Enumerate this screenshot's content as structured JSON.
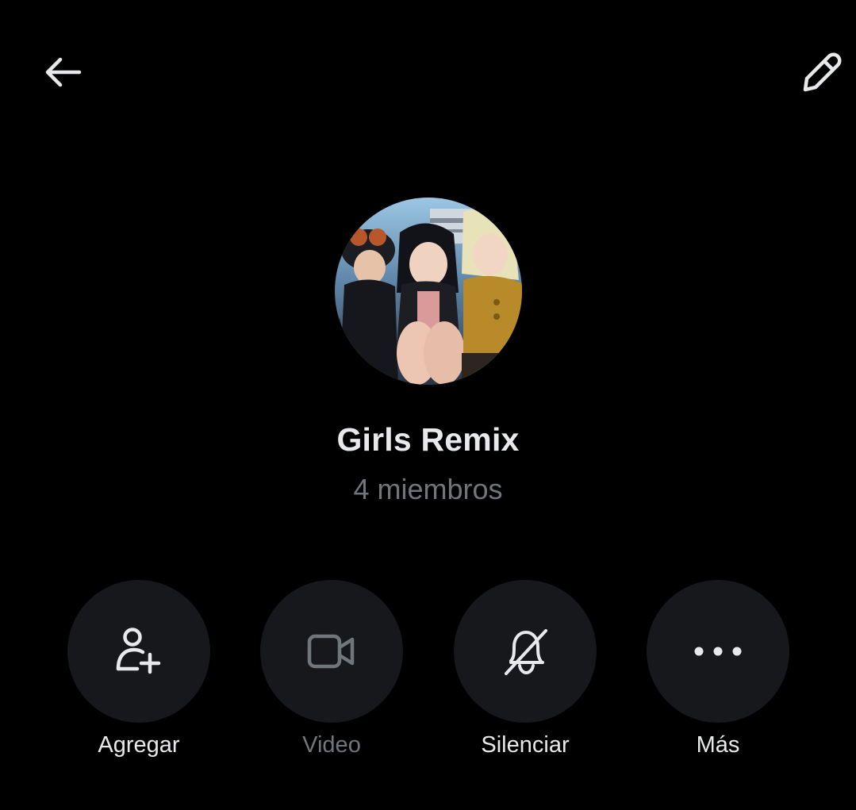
{
  "header": {
    "back_icon": "arrow-left-icon",
    "edit_icon": "pencil-icon"
  },
  "group": {
    "name": "Girls Remix",
    "member_count": "4 miembros"
  },
  "actions": [
    {
      "label": "Agregar",
      "icon": "add-person-icon",
      "enabled": true
    },
    {
      "label": "Video",
      "icon": "video-camera-icon",
      "enabled": false
    },
    {
      "label": "Silenciar",
      "icon": "bell-off-icon",
      "enabled": true
    },
    {
      "label": "Más",
      "icon": "more-dots-icon",
      "enabled": true
    }
  ],
  "colors": {
    "background": "#000000",
    "primary_text": "#e7e9ea",
    "secondary_text": "#71767b",
    "button_bg": "#16181c"
  }
}
